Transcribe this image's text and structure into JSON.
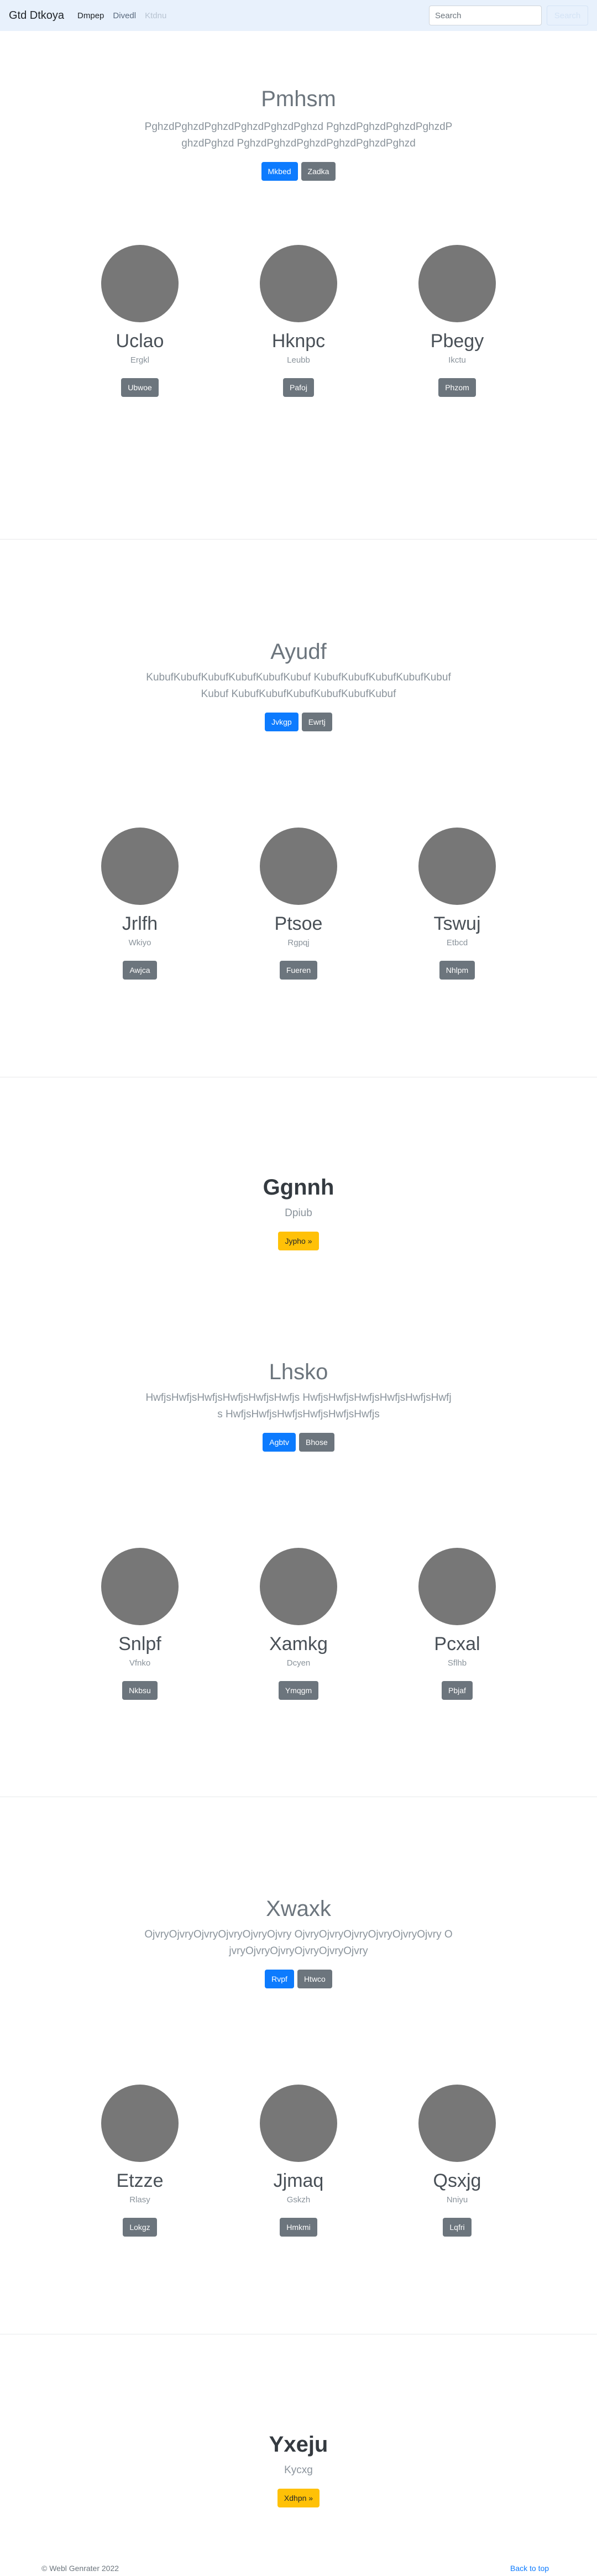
{
  "nav": {
    "brand": "Gtd Dtkoya",
    "links": [
      "Dmpep",
      "Divedl",
      "Ktdnu"
    ],
    "search_placeholder": "Search",
    "search_button": "Search"
  },
  "sections": [
    {
      "title": "Pmhsm",
      "lead": "PghzdPghzdPghzdPghzdPghzdPghzd PghzdPghzdPghzdPghzdPghzdPghzd PghzdPghzdPghzdPghzdPghzdPghzd",
      "buttons": [
        "Mkbed",
        "Zadka"
      ]
    },
    {
      "title": "Ayudf",
      "lead": "KubufKubufKubufKubufKubufKubuf KubufKubufKubufKubufKubufKubuf KubufKubufKubufKubufKubufKubuf",
      "buttons": [
        "Jvkgp",
        "Ewrtj"
      ]
    },
    {
      "title": "Ggnnh",
      "lead": "Dpiub",
      "buttons": [
        "Jypho »"
      ]
    },
    {
      "title": "Lhsko",
      "lead": "HwfjsHwfjsHwfjsHwfjsHwfjsHwfjs HwfjsHwfjsHwfjsHwfjsHwfjsHwfjs HwfjsHwfjsHwfjsHwfjsHwfjsHwfjs",
      "buttons": [
        "Agbtv",
        "Bhose"
      ]
    },
    {
      "title": "Xwaxk",
      "lead": "OjvryOjvryOjvryOjvryOjvryOjvry OjvryOjvryOjvryOjvryOjvryOjvry OjvryOjvryOjvryOjvryOjvryOjvry",
      "buttons": [
        "Rvpf",
        "Htwco"
      ]
    },
    {
      "title": "Yxeju",
      "lead": "Kycxg",
      "buttons": [
        "Xdhpn »"
      ]
    }
  ],
  "people_groups": [
    [
      {
        "name": "Uclao",
        "role": "Ergkl",
        "button": "Ubwoe"
      },
      {
        "name": "Hknpc",
        "role": "Leubb",
        "button": "Pafoj"
      },
      {
        "name": "Pbegy",
        "role": "Ikctu",
        "button": "Phzom"
      }
    ],
    [
      {
        "name": "Jrlfh",
        "role": "Wkiyo",
        "button": "Awjca"
      },
      {
        "name": "Ptsoe",
        "role": "Rgpqj",
        "button": "Fueren"
      },
      {
        "name": "Tswuj",
        "role": "Etbcd",
        "button": "Nhlpm"
      }
    ],
    [
      {
        "name": "Snlpf",
        "role": "Vfnko",
        "button": "Nkbsu"
      },
      {
        "name": "Xamkg",
        "role": "Dcyen",
        "button": "Ymqgm"
      },
      {
        "name": "Pcxal",
        "role": "Sflhb",
        "button": "Pbjaf"
      }
    ],
    [
      {
        "name": "Etzze",
        "role": "Rlasy",
        "button": "Lokgz"
      },
      {
        "name": "Jjmaq",
        "role": "Gskzh",
        "button": "Hmkmi"
      },
      {
        "name": "Qsxjg",
        "role": "Nniyu",
        "button": "Lqfri"
      }
    ]
  ],
  "footer": {
    "copyright": "© Webl Genrater 2022",
    "back_to_top": "Back to top"
  },
  "colors": {
    "primary": "#0d7bfe",
    "secondary": "#6c757d",
    "warning": "#ffc107",
    "navbar_bg": "#e8f1fc",
    "avatar": "#777777"
  }
}
